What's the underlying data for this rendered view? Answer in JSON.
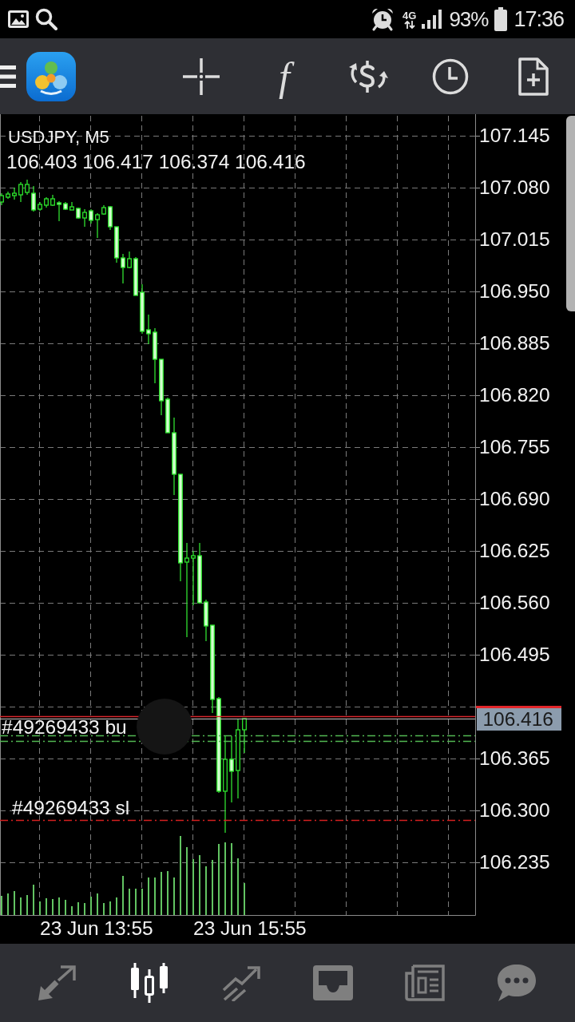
{
  "status_bar": {
    "network": "4G",
    "battery": "93%",
    "time": "17:36"
  },
  "toolbar": {
    "function_glyph": "f"
  },
  "chart": {
    "title": "USDJPY, M5",
    "ohlc": "106.403 106.417 106.374 106.416",
    "price_labels": [
      "107.145",
      "107.080",
      "107.015",
      "106.950",
      "106.885",
      "106.820",
      "106.755",
      "106.690",
      "106.625",
      "106.560",
      "106.495",
      "106.365",
      "106.300",
      "106.235"
    ],
    "current_price": "106.416",
    "orders": [
      {
        "kind": "buy",
        "label": "#49269433 bu"
      },
      {
        "kind": "stop_loss",
        "label": "#49269433 sl"
      }
    ],
    "time_labels": [
      "23 Jun 13:55",
      "23 Jun 15:55"
    ]
  },
  "bottom_nav": {
    "items": [
      {
        "selected": false
      },
      {
        "selected": true
      },
      {
        "selected": false
      },
      {
        "selected": false
      },
      {
        "selected": false
      },
      {
        "selected": false
      }
    ]
  }
}
